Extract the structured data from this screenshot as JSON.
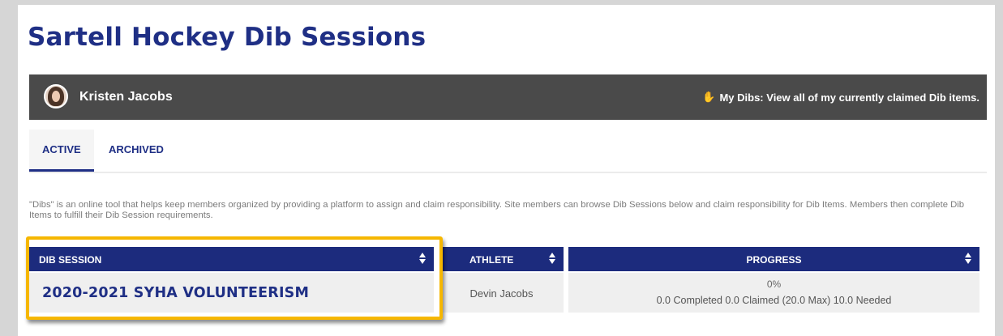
{
  "page": {
    "title": "Sartell Hockey Dib Sessions"
  },
  "user_bar": {
    "user_name": "Kristen Jacobs",
    "my_dibs_icon": "raised-hand-icon",
    "my_dibs_label": "My Dibs: View all of my currently claimed Dib items."
  },
  "tabs": [
    {
      "label": "ACTIVE",
      "selected": true
    },
    {
      "label": "ARCHIVED",
      "selected": false
    }
  ],
  "description": "\"Dibs\" is an online tool that helps keep members organized by providing a platform to assign and claim responsibility. Site members can browse Dib Sessions below and claim responsibility for Dib Items. Members then complete Dib Items to fulfill their Dib Session requirements.",
  "table": {
    "columns": [
      "DIB SESSION",
      "ATHLETE",
      "PROGRESS"
    ],
    "rows": [
      {
        "session": "2020-2021 SYHA VOLUNTEERISM",
        "athlete": "Devin Jacobs",
        "progress_percent": "0%",
        "progress_detail": "0.0 Completed 0.0 Claimed (20.0 Max) 10.0 Needed"
      }
    ]
  },
  "colors": {
    "brand_blue": "#1f2f85",
    "header_blue": "#1c2b7d",
    "user_bar": "#4a4a4a",
    "highlight": "#f6b700"
  }
}
